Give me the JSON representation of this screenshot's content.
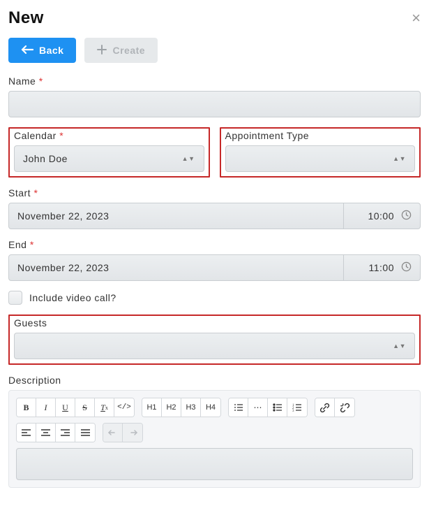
{
  "header": {
    "title": "New"
  },
  "buttons": {
    "back": "Back",
    "create": "Create"
  },
  "fields": {
    "name": {
      "label": "Name",
      "value": ""
    },
    "calendar": {
      "label": "Calendar",
      "value": "John Doe"
    },
    "appt_type": {
      "label": "Appointment Type",
      "value": ""
    },
    "start": {
      "label": "Start",
      "date": "November 22, 2023",
      "time": "10:00"
    },
    "end": {
      "label": "End",
      "date": "November 22, 2023",
      "time": "11:00"
    },
    "video": {
      "label": "Include video call?",
      "checked": false
    },
    "guests": {
      "label": "Guests",
      "value": ""
    },
    "description": {
      "label": "Description",
      "value": ""
    }
  },
  "toolbar": {
    "bold": "B",
    "italic": "I",
    "underline": "U",
    "strike": "S",
    "h1": "H1",
    "h2": "H2",
    "h3": "H3",
    "h4": "H4"
  }
}
